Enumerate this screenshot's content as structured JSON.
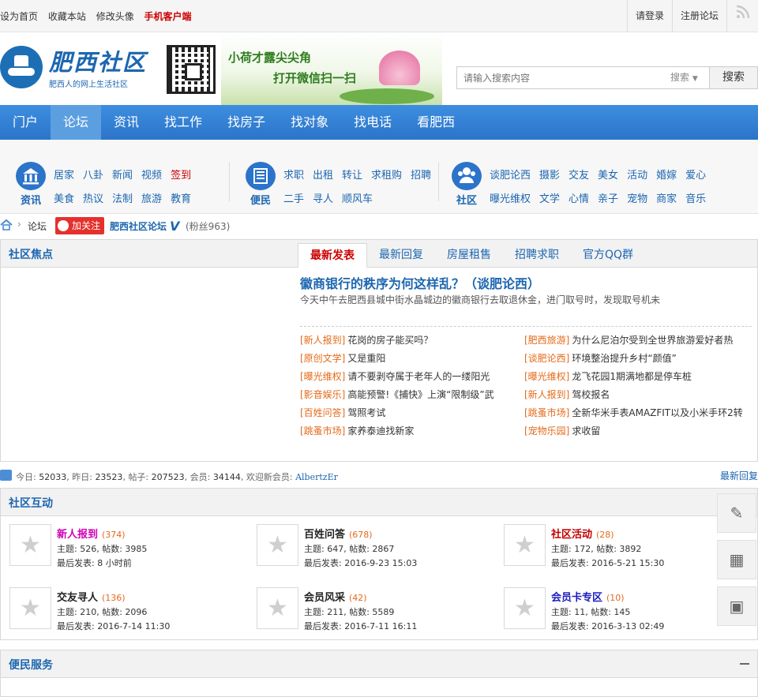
{
  "topbar": {
    "left_links": [
      "设为首页",
      "收藏本站",
      "修改头像"
    ],
    "mobile": "手机客户端",
    "login": "请登录",
    "register": "注册论坛"
  },
  "header": {
    "logo_text": "肥西社区",
    "logo_slogan": "肥西人的网上生活社区",
    "banner_line1": "小荷才露尖尖角",
    "banner_line2": "打开微信扫一扫",
    "search_placeholder": "请输入搜索内容",
    "search_select": "搜索",
    "search_button": "搜索"
  },
  "main_nav": [
    "门户",
    "论坛",
    "资讯",
    "找工作",
    "找房子",
    "找对象",
    "找电话",
    "看肥西"
  ],
  "main_nav_active": 1,
  "sub_nav": [
    {
      "label": "资讯",
      "icon": "bank-icon",
      "links": [
        "居家",
        "八卦",
        "新闻",
        "视频",
        "签到",
        "美食",
        "热议",
        "法制",
        "旅游",
        "教育"
      ],
      "red": [
        4
      ]
    },
    {
      "label": "便民",
      "icon": "building-icon",
      "links": [
        "求职",
        "出租",
        "转让",
        "求租购",
        "招聘",
        "二手",
        "寻人",
        "顺风车"
      ],
      "red": []
    },
    {
      "label": "社区",
      "icon": "users-icon",
      "links": [
        "谈肥论西",
        "摄影",
        "交友",
        "美女",
        "活动",
        "婚嫁",
        "爱心",
        "曝光维权",
        "文学",
        "心情",
        "亲子",
        "宠物",
        "商家",
        "音乐"
      ],
      "red": []
    }
  ],
  "breadcrumb": {
    "forum": "论坛",
    "weibo_follow": "加关注",
    "account": "肥西社区论坛",
    "verified": "V",
    "fans": "(粉丝963)"
  },
  "focus": {
    "title": "社区焦点",
    "tabs": [
      "最新发表",
      "最新回复",
      "房屋租售",
      "招聘求职",
      "官方QQ群"
    ],
    "active_tab": 0,
    "headline": "徽商银行的秩序为何这样乱？（谈肥论西）",
    "summary": "今天中午去肥西县城中街水晶城边的徽商银行去取退休金，进门取号时，发现取号机未",
    "posts_left": [
      {
        "cat": "[新人报到]",
        "title": "花岗的房子能买吗？"
      },
      {
        "cat": "[原创文学]",
        "title": "又是重阳"
      },
      {
        "cat": "[曝光维权]",
        "title": "请不要剥夺属于老年人的一缕阳光"
      },
      {
        "cat": "[影音娱乐]",
        "title": "高能预警!《捕快》上演“限制级”武"
      },
      {
        "cat": "[百姓问答]",
        "title": "驾照考试"
      },
      {
        "cat": "[跳蚤市场]",
        "title": "家养泰迪找新家"
      }
    ],
    "posts_right": [
      {
        "cat": "[肥西旅游]",
        "title": "为什么尼泊尔受到全世界旅游爱好者热"
      },
      {
        "cat": "[谈肥论西]",
        "title": "环境整治提升乡村“颜值”"
      },
      {
        "cat": "[曝光维权]",
        "title": "龙飞花园1期满地都是停车桩"
      },
      {
        "cat": "[新人报到]",
        "title": "驾校报名"
      },
      {
        "cat": "[跳蚤市场]",
        "title": "全新华米手表AMAZFIT以及小米手环2转"
      },
      {
        "cat": "[宠物乐园]",
        "title": "求收留"
      }
    ]
  },
  "stats": {
    "today_label": "今日:",
    "today": "52033",
    "yesterday_label": "昨日:",
    "yesterday": "23523",
    "posts_label": "帖子:",
    "posts": "207523",
    "members_label": "会员:",
    "members": "34144",
    "welcome_label": "欢迎新会员:",
    "new_member": "AlbertzEr",
    "recent_reply": "最新回复"
  },
  "community": {
    "title": "社区互动",
    "boards": [
      {
        "name": "新人报到",
        "color": "#d000b5",
        "count": "(374)",
        "stats": "主题: 526, 帖数: 3985",
        "last": "最后发表: 8 小时前"
      },
      {
        "name": "百姓问答",
        "color": "#222222",
        "count": "(678)",
        "stats": "主题: 647, 帖数: 2867",
        "last": "最后发表: 2016-9-23 15:03"
      },
      {
        "name": "社区活动",
        "color": "#c00000",
        "count": "(28)",
        "stats": "主题: 172, 帖数: 3892",
        "last": "最后发表: 2016-5-21 15:30"
      },
      {
        "name": "交友寻人",
        "color": "#222222",
        "count": "(136)",
        "stats": "主题: 210, 帖数: 2096",
        "last": "最后发表: 2016-7-14 11:30"
      },
      {
        "name": "会员风采",
        "color": "#222222",
        "count": "(42)",
        "stats": "主题: 211, 帖数: 5589",
        "last": "最后发表: 2016-7-11 16:11"
      },
      {
        "name": "会员卡专区",
        "color": "#1c1cc0",
        "count": "(10)",
        "stats": "主题: 11, 帖数: 145",
        "last": "最后发表: 2016-3-13 02:49"
      }
    ]
  },
  "service": {
    "title": "便民服务"
  },
  "side_tools": [
    {
      "name": "post-button",
      "icon": "pencil-icon",
      "glyph": "✎"
    },
    {
      "name": "checkin-button",
      "icon": "calendar-icon",
      "glyph": "▦"
    },
    {
      "name": "qrcode-button",
      "icon": "qrcode-icon",
      "glyph": "▣"
    }
  ]
}
